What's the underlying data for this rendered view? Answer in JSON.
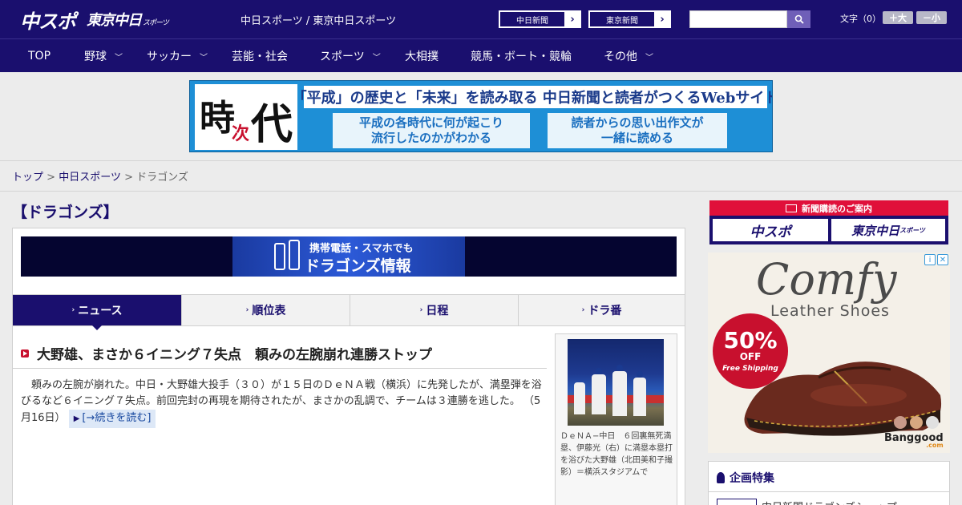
{
  "header": {
    "logo_chuspo": "中スポ",
    "logo_tokyo": "東京中日",
    "logo_tokyo_suffix": "スポーツ",
    "site_links": "中日スポーツ / 東京中日スポーツ",
    "btn_chunichi": "中日新聞",
    "btn_tokyo": "東京新聞",
    "search_placeholder": "",
    "font_label": "文字（0）",
    "font_larger": "＋大",
    "font_smaller": "－小"
  },
  "nav": {
    "items": [
      {
        "label": "TOP",
        "has_menu": false
      },
      {
        "label": "野球",
        "has_menu": true
      },
      {
        "label": "サッカー",
        "has_menu": true
      },
      {
        "label": "芸能・社会",
        "has_menu": false
      },
      {
        "label": "スポーツ",
        "has_menu": true
      },
      {
        "label": "大相撲",
        "has_menu": false
      },
      {
        "label": "競馬・ボート・競輪",
        "has_menu": false
      },
      {
        "label": "その他",
        "has_menu": true
      }
    ]
  },
  "banner": {
    "kanji_1": "時",
    "kanji_2": "次",
    "kanji_3": "代",
    "headline": "「平成」の歴史と「未来」を読み取る 中日新聞と読者がつくるWebサイト",
    "sub_left_1": "平成の各時代に何が起こり",
    "sub_left_2": "流行したのかがわかる",
    "sub_right_1": "読者からの思い出作文が",
    "sub_right_2": "一緒に読める"
  },
  "breadcrumb": {
    "home": "トップ",
    "section": "中日スポーツ",
    "current": "ドラゴンズ",
    "sep": ">"
  },
  "page": {
    "heading": "【ドラゴンズ】"
  },
  "mobile_banner": {
    "line1": "携帯電話・スマホでも",
    "line2": "ドラゴンズ情報"
  },
  "tabs": [
    {
      "label": "ニュース",
      "active": true
    },
    {
      "label": "順位表",
      "active": false
    },
    {
      "label": "日程",
      "active": false
    },
    {
      "label": "ドラ番",
      "active": false
    }
  ],
  "article": {
    "title": "大野雄、まさか６イニング７失点　頼みの左腕崩れ連勝ストップ",
    "body": "頼みの左腕が崩れた。中日・大野雄大投手（３０）が１５日のＤｅＮＡ戦（横浜）に先発したが、満塁弾を浴びるなど６イニング７失点。前回完封の再現を期待されたが、まさかの乱調で、チームは３連勝を逃した。",
    "date": "（5月16日）",
    "read_more": "[→続きを読む]",
    "photo_caption": "ＤｅＮＡ−中日　６回裏無死満塁、伊藤光（右）に満塁本塁打を浴びた大野雄（北田美和子撮影）＝横浜スタジアムで"
  },
  "sidebar": {
    "subscribe_title": "新聞購読のご案内",
    "subscribe_chuspo": "中スポ",
    "subscribe_tokyo": "東京中日",
    "subscribe_tokyo_suffix": "スポーツ",
    "ad": {
      "brand_line1": "Comfy",
      "brand_line2": "Leather Shoes",
      "discount": "50%",
      "discount_suffix": "OFF",
      "shipping": "Free Shipping",
      "store": "Banggood",
      "store_suffix": ".com",
      "info_icon": "i",
      "close_icon": "✕",
      "colors": [
        "#c89a8a",
        "#d8a880",
        "#e0e0e0"
      ]
    },
    "special_title": "企画特集",
    "special_item": "中日新聞ドラゴンズショップ"
  },
  "colors": {
    "brand_navy": "#1a0f6e",
    "accent_red": "#c8102e",
    "banner_blue": "#1e8fd6"
  }
}
